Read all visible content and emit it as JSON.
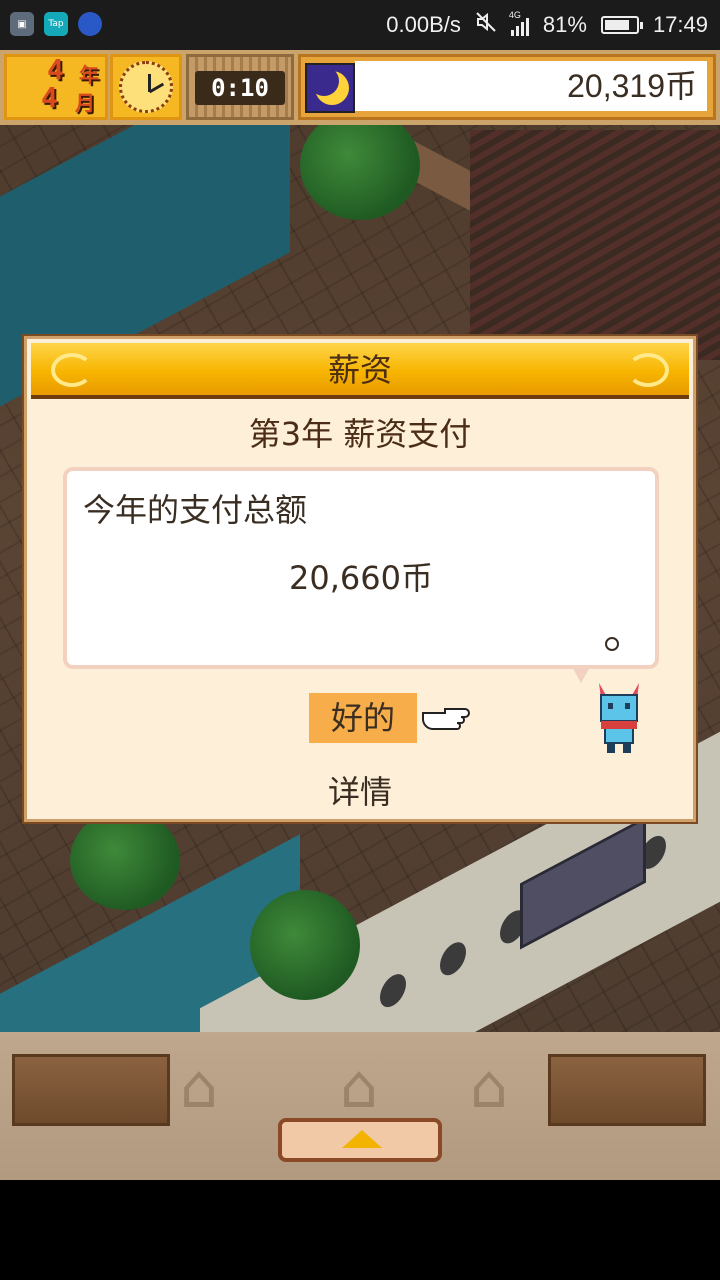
{
  "status_bar": {
    "left_icons": [
      "gallery-icon",
      "taptap-icon",
      "browser-icon"
    ],
    "taptap_text": "Tap",
    "network_speed": "0.00B/s",
    "signal": "4G",
    "battery": "81%",
    "battery_level": 0.81,
    "time": "17:49"
  },
  "hud": {
    "year_num": "4",
    "year_unit": "年",
    "month_num": "4",
    "month_unit": "月",
    "time": "0:10",
    "money": "20,319币"
  },
  "dialog": {
    "title": "薪资",
    "subtitle": "第3年 薪资支付",
    "label": "今年的支付总额",
    "amount": "20,660币",
    "ok_button": "好的",
    "details_button": "详情"
  },
  "colors": {
    "header_gold": "#f7b500",
    "dialog_bg": "#fdefd8",
    "ok_highlight": "#f6ad4a",
    "text": "#3a2d22"
  }
}
